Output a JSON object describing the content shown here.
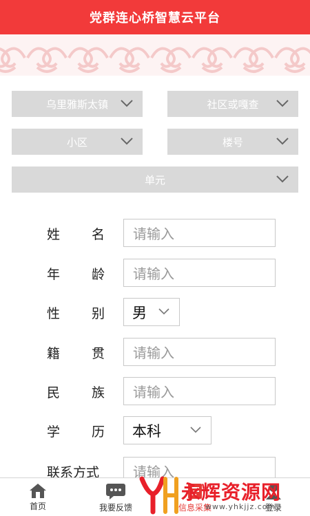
{
  "header": {
    "title": "党群连心桥智慧云平台"
  },
  "filters": {
    "town": {
      "value": "乌里雅斯太镇"
    },
    "community": {
      "value": "社区或嘎查"
    },
    "residence": {
      "value": "小区"
    },
    "building": {
      "value": "楼号"
    },
    "unit": {
      "value": "单元"
    }
  },
  "form": {
    "name": {
      "label_a": "姓",
      "label_b": "名",
      "placeholder": "请输入"
    },
    "age": {
      "label_a": "年",
      "label_b": "龄",
      "placeholder": "请输入"
    },
    "gender": {
      "label_a": "性",
      "label_b": "别",
      "value": "男"
    },
    "origin": {
      "label_a": "籍",
      "label_b": "贯",
      "placeholder": "请输入"
    },
    "ethnicity": {
      "label_a": "民",
      "label_b": "族",
      "placeholder": "请输入"
    },
    "education": {
      "label_a": "学",
      "label_b": "历",
      "value": "本科"
    },
    "contact": {
      "label": "联系方式",
      "placeholder": "请输入"
    }
  },
  "bottom_nav": {
    "items": [
      {
        "label": "首页",
        "icon": "home-icon"
      },
      {
        "label": "我要反馈",
        "icon": "chat-icon"
      },
      {
        "label": "信息采集",
        "icon": "info-collect-icon",
        "active": true
      },
      {
        "label": "登录",
        "icon": "user-icon"
      }
    ]
  },
  "watermark": {
    "brand": "永辉资源网",
    "url": "www.yhkjjz.com"
  },
  "colors": {
    "primary": "#f23a3a",
    "select_bg": "#d9d9d9",
    "pattern": "#f7d7d7"
  }
}
